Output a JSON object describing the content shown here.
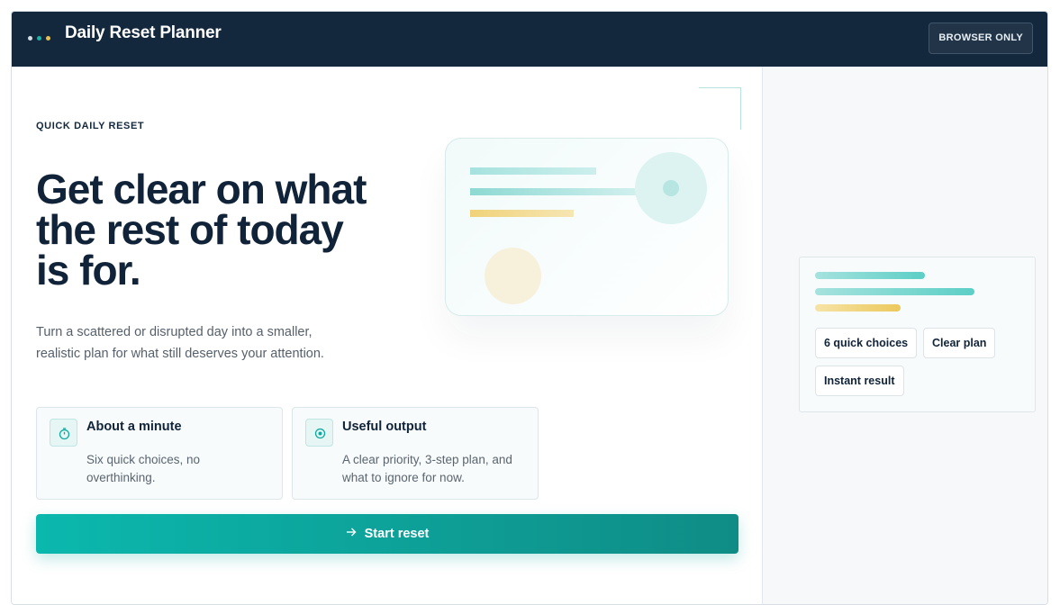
{
  "header": {
    "title": "Daily Reset Planner",
    "badge": "BROWSER ONLY",
    "dot_colors": [
      "#d7dde3",
      "#17b4a8",
      "#e8c14a"
    ]
  },
  "hero": {
    "eyebrow": "QUICK DAILY RESET",
    "headline": "Get clear on what the rest of today is for.",
    "lead": "Turn a scattered or disrupted day into a smaller, realistic plan for what still deserves your attention."
  },
  "features": [
    {
      "icon": "stopwatch-icon",
      "title": "About a minute",
      "body": "Six quick choices, no overthinking."
    },
    {
      "icon": "target-icon",
      "title": "Useful output",
      "body": "A clear priority, 3-step plan, and what to ignore for now."
    }
  ],
  "cta": {
    "label": "Start reset",
    "icon": "arrow-right-icon"
  },
  "preview": {
    "chips": [
      "6 quick choices",
      "Clear plan",
      "Instant result"
    ]
  },
  "colors": {
    "navy": "#13283c",
    "teal": "#0bb8ad",
    "yellow": "#f0d27a"
  }
}
